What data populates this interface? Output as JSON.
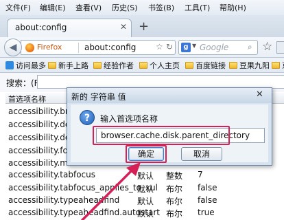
{
  "menubar": {
    "items": [
      "文件(F)",
      "编辑(E)",
      "查看(V)",
      "历史(S)",
      "书签(B)",
      "工具(T)",
      "帮助(H)"
    ]
  },
  "tab": {
    "title": "about:config",
    "close": "✕",
    "new_tab": "+"
  },
  "nav": {
    "identity_label": "Firefox",
    "url": "about:config",
    "search_engine": "g",
    "search_placeholder": "Google",
    "bookmark_icon": "star-icon"
  },
  "bookmarks": {
    "items": [
      {
        "label": "访问最多",
        "icon": "bookmark-item-icon"
      },
      {
        "label": "新手上路",
        "icon": "folder-icon"
      },
      {
        "label": "经验作者",
        "icon": "folder-icon"
      },
      {
        "label": "个人主页",
        "icon": "folder-icon"
      },
      {
        "label": "百度链接",
        "icon": "folder-icon"
      },
      {
        "label": "豆果九阳",
        "icon": "folder-icon"
      },
      {
        "label": "京",
        "icon": "folder-icon"
      }
    ]
  },
  "filter": {
    "label": "搜索：(R)"
  },
  "prefs": {
    "header": {
      "name": "首选项名称"
    },
    "rows": [
      {
        "name": "accessibility.brow",
        "status": "",
        "type": "",
        "value": ""
      },
      {
        "name": "accessibility.delay",
        "status": "",
        "type": "",
        "value": ""
      },
      {
        "name": "accessibility.delay",
        "status": "",
        "type": "",
        "value": ""
      },
      {
        "name": "accessibility.force",
        "status": "",
        "type": "",
        "value": ""
      },
      {
        "name": "accessibility.mous",
        "status": "",
        "type": "",
        "value": ""
      },
      {
        "name": "accessibility.tabfocus",
        "status": "默认",
        "type": "整数",
        "value": "7"
      },
      {
        "name": "accessibility.tabfocus_applies_to_xul",
        "status": "默认",
        "type": "布尔",
        "value": "false"
      },
      {
        "name": "accessibility.typeaheadfind",
        "status": "默认",
        "type": "布尔",
        "value": "false"
      },
      {
        "name": "accessibility.typeaheadfind.autostart",
        "status": "默认",
        "type": "布尔",
        "value": "true"
      }
    ]
  },
  "dialog": {
    "title": "新的 字符串 值",
    "prompt": "输入首选项名称",
    "input_value": "browser.cache.disk.parent_directory",
    "ok_label": "确定",
    "cancel_label": "取消",
    "close": "✕"
  },
  "colors": {
    "highlight": "#d61f57",
    "accent": "#3c7fd0"
  }
}
